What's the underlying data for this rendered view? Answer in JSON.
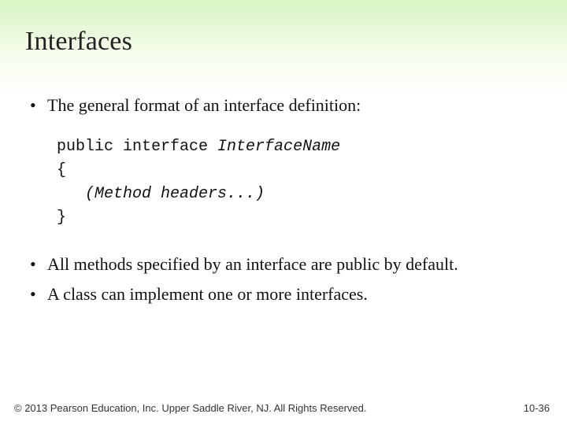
{
  "title": "Interfaces",
  "bullets": {
    "b1": "The general format of an interface definition:",
    "b2": "All methods specified by an interface are public by default.",
    "b3": "A class can implement one or more interfaces."
  },
  "code": {
    "l1_a": "public interface ",
    "l1_b": "InterfaceName",
    "l2": "{",
    "l3": "   (Method headers...)",
    "l4": "}"
  },
  "footer": "© 2013 Pearson Education, Inc. Upper Saddle River, NJ. All Rights Reserved.",
  "page": "10-36"
}
